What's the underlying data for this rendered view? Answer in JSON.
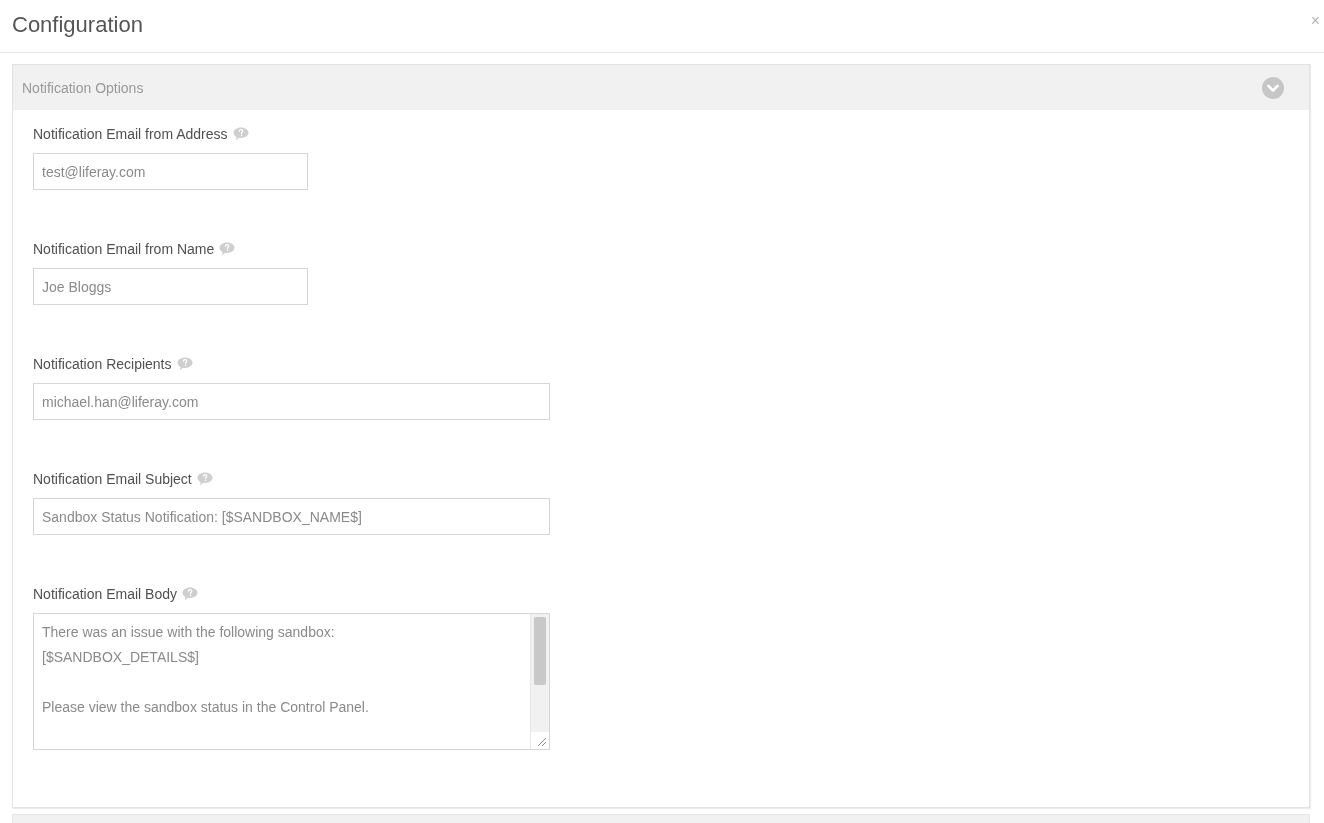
{
  "dialog": {
    "title": "Configuration",
    "close": "×"
  },
  "panel": {
    "title": "Notification Options",
    "expanded": true,
    "fields": [
      {
        "label": "Notification Email from Address",
        "kind": "short",
        "value": "test@liferay.com"
      },
      {
        "label": "Notification Email from Name",
        "kind": "short",
        "value": "Joe Bloggs"
      },
      {
        "label": "Notification Recipients",
        "kind": "long",
        "value": "michael.han@liferay.com"
      },
      {
        "label": "Notification Email Subject",
        "kind": "long",
        "value": "Sandbox Status Notification: [$SANDBOX_NAME$]"
      },
      {
        "label": "Notification Email Body",
        "kind": "multiline",
        "value": "There was an issue with the following sandbox:\n[$SANDBOX_DETAILS$]\n\nPlease view the sandbox status in the Control Panel."
      }
    ]
  }
}
